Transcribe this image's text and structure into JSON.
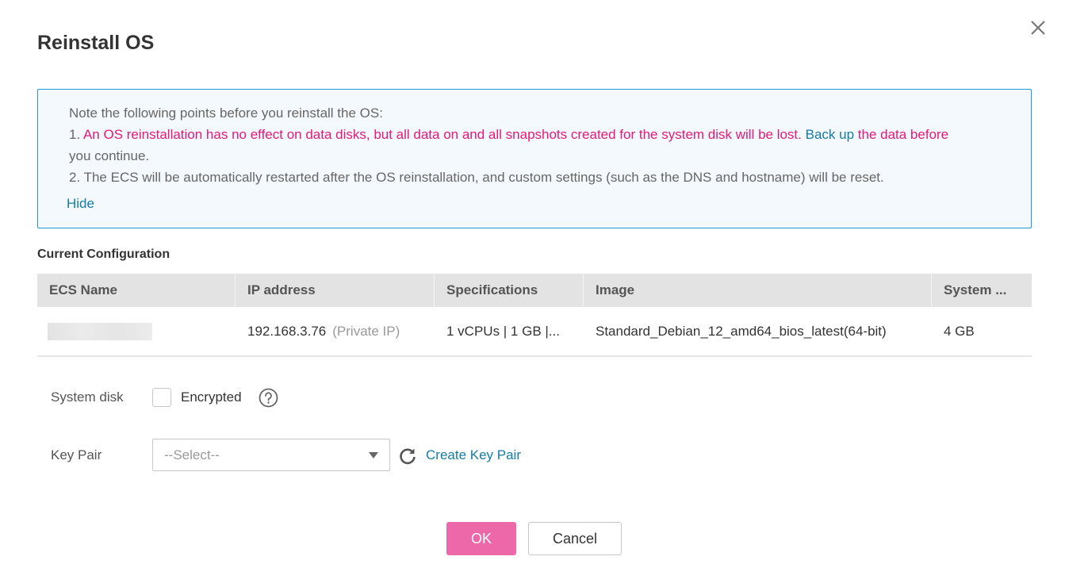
{
  "dialog": {
    "title": "Reinstall OS",
    "close_icon": "close-icon"
  },
  "notice": {
    "intro": "Note the following points before you reinstall the OS:",
    "point1_prefix": "1. ",
    "point1_warning": "An OS reinstallation has no effect on data disks, but all data on and all snapshots created for the system disk will be lost. ",
    "point1_link": "Back up",
    "point1_suffix_line1": " the data before",
    "point1_suffix_line2": "you continue.",
    "point2": "2. The ECS will be automatically restarted after the OS reinstallation, and custom settings (such as the DNS and hostname) will be reset.",
    "hide_label": "Hide",
    "colors": {
      "warning": "#e5197a",
      "link": "#167ba5",
      "border": "#1b9ad6",
      "background": "#f4f9fd"
    }
  },
  "current_configuration": {
    "label": "Current Configuration",
    "columns": [
      "ECS Name",
      "IP address",
      "Specifications",
      "Image",
      "System ..."
    ],
    "rows": [
      {
        "ecs_name": "",
        "ecs_name_blurred": true,
        "ip": "192.168.3.76",
        "ip_type": "(Private IP)",
        "specifications": "1 vCPUs | 1 GB |...",
        "image": "Standard_Debian_12_amd64_bios_latest(64-bit)",
        "system_disk": "4 GB"
      }
    ]
  },
  "form": {
    "system_disk_label": "System disk",
    "encrypted_label": "Encrypted",
    "encrypted_checked": false,
    "help_icon": "question-circle-icon",
    "key_pair_label": "Key Pair",
    "key_pair_placeholder": "--Select--",
    "refresh_icon": "refresh-icon",
    "create_key_pair_label": "Create Key Pair"
  },
  "footer": {
    "ok_label": "OK",
    "cancel_label": "Cancel",
    "ok_color": "#ed68a9"
  }
}
